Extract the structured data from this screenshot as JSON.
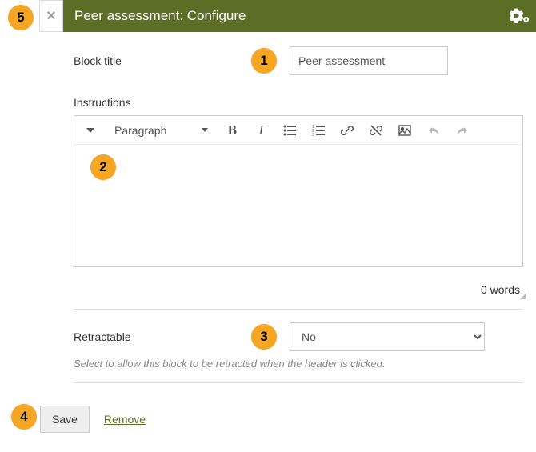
{
  "header": {
    "title": "Peer assessment: Configure"
  },
  "form": {
    "block_title_label": "Block title",
    "block_title_value": "Peer assessment",
    "instructions_label": "Instructions",
    "format_label": "Paragraph",
    "word_count": "0 words",
    "retractable_label": "Retractable",
    "retractable_value": "No",
    "retractable_help": "Select to allow this block to be retracted when the header is clicked."
  },
  "actions": {
    "save_label": "Save",
    "remove_label": "Remove"
  },
  "callouts": {
    "c1": "1",
    "c2": "2",
    "c3": "3",
    "c4": "4",
    "c5": "5"
  }
}
